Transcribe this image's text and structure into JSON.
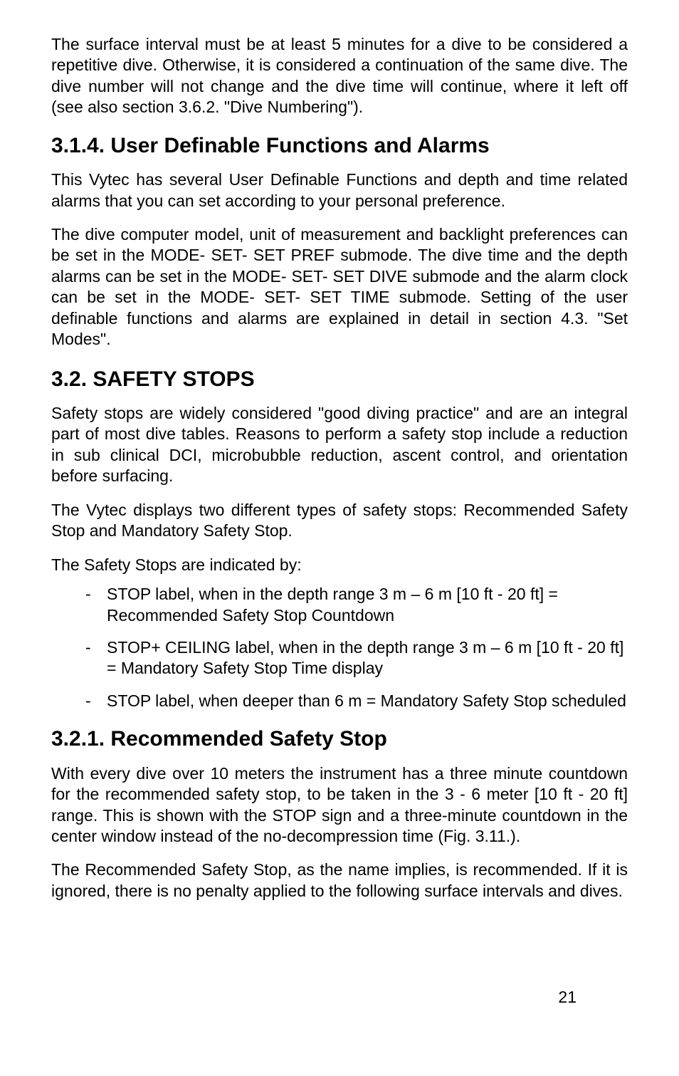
{
  "p_intro": "The surface interval must be at least 5 minutes for a dive to be considered a repetitive dive. Otherwise, it is considered a continuation of the same dive. The dive number will not change and the dive time will continue, where it left off (see also section 3.6.2. \"Dive Numbering\").",
  "h_314": "3.1.4.  User Definable Functions and Alarms",
  "p_314a": "This Vytec has several User Definable Functions and depth and time related alarms that you can set according to your personal preference.",
  "p_314b": "The dive computer model, unit of measurement and backlight preferences can be set in the MODE- SET- SET PREF submode. The dive time and the depth alarms can be set in the MODE- SET- SET DIVE submode and the alarm clock can be set in the MODE- SET- SET TIME submode. Setting of the user definable functions and alarms are explained in detail in section 4.3. \"Set Modes\".",
  "h_32": "3.2.  SAFETY STOPS",
  "p_32a": "Safety stops are widely considered \"good diving practice\" and are an integral part of most dive tables. Reasons to perform a safety stop include a reduction in sub clinical DCI, microbubble reduction, ascent control, and orientation before surfacing.",
  "p_32b": "The Vytec displays two different types of safety stops: Recommended Safety Stop and Mandatory Safety Stop.",
  "p_32c": "The Safety Stops are indicated by:",
  "li1": "STOP label, when in the depth range 3 m – 6 m [10 ft - 20 ft] = Recommended Safety Stop Countdown",
  "li2": "STOP+ CEILING label, when in the depth range 3 m – 6 m [10 ft - 20 ft] = Mandatory Safety Stop Time display",
  "li3": "STOP label, when deeper than 6 m = Mandatory Safety Stop scheduled",
  "h_321": "3.2.1.  Recommended Safety Stop",
  "p_321a": "With every dive over 10 meters the instrument has a three minute countdown for the recommended safety stop, to be taken in the 3 - 6 meter [10 ft - 20 ft] range. This is shown with the STOP sign and a three-minute countdown in the center window instead of the no-decompression time (Fig. 3.11.).",
  "p_321b": "The Recommended Safety Stop, as the name implies, is recommended. If it is ignored, there is no penalty applied to the following surface intervals and dives.",
  "pagenum": "21"
}
